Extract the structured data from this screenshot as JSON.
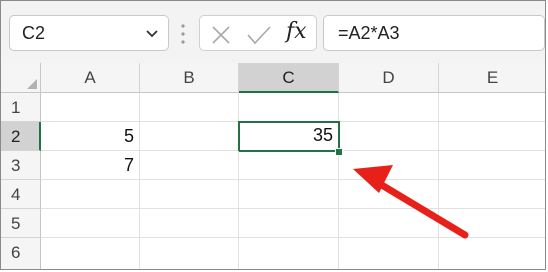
{
  "name_box": {
    "value": "C2",
    "dropdown_icon": "chevron-down-icon"
  },
  "formula_bar": {
    "cancel_icon": "cancel-x-icon",
    "enter_icon": "checkmark-icon",
    "fx_label": "fx",
    "formula": "=A2*A3"
  },
  "columns": [
    "A",
    "B",
    "C",
    "D",
    "E"
  ],
  "rows": [
    "1",
    "2",
    "3",
    "4",
    "5",
    "6"
  ],
  "cells": {
    "A2": "5",
    "A3": "7",
    "C2": "35"
  },
  "selected_cell": "C2",
  "colors": {
    "selection": "#217346",
    "annotation_arrow": "#e8201a"
  }
}
